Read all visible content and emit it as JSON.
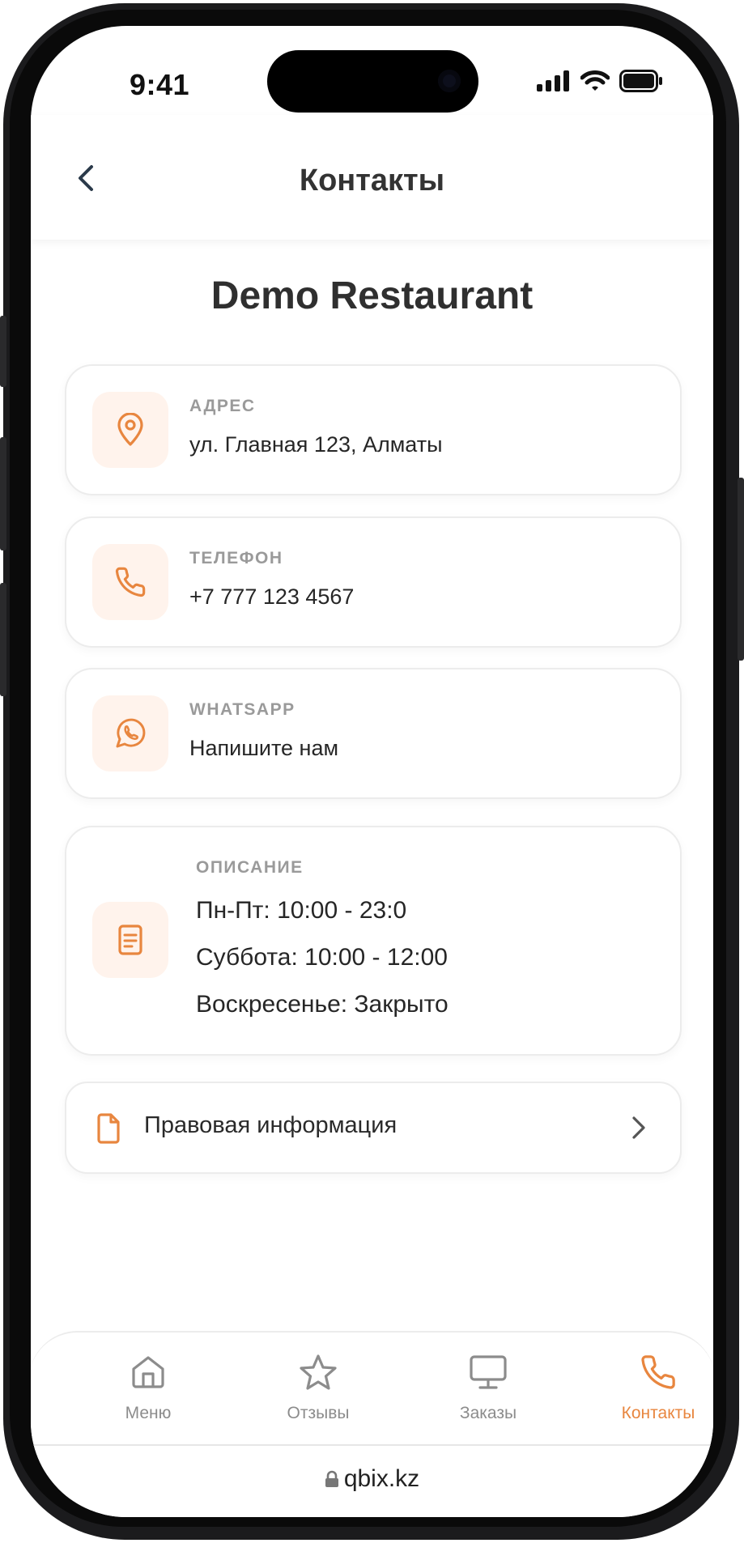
{
  "status": {
    "time": "9:41"
  },
  "header": {
    "title": "Контакты"
  },
  "restaurant": {
    "name": "Demo Restaurant"
  },
  "cards": {
    "address": {
      "label": "АДРЕС",
      "value": "ул. Главная 123, Алматы"
    },
    "phone": {
      "label": "ТЕЛЕФОН",
      "value": "+7 777 123 4567"
    },
    "whatsapp": {
      "label": "WHATSAPP",
      "value": "Напишите нам"
    },
    "description": {
      "label": "ОПИСАНИЕ",
      "lines": [
        "Пн-Пт: 10:00 - 23:0",
        "Суббота: 10:00 - 12:00",
        "Воскресенье: Закрыто"
      ]
    }
  },
  "legal": {
    "label": "Правовая информация"
  },
  "tabs": [
    {
      "label": "Меню",
      "icon": "home-icon"
    },
    {
      "label": "Отзывы",
      "icon": "star-icon"
    },
    {
      "label": "Заказы",
      "icon": "monitor-icon"
    },
    {
      "label": "Контакты",
      "icon": "phone-icon",
      "active": true
    }
  ],
  "browser": {
    "url": "qbix.kz"
  },
  "colors": {
    "accent": "#e8863f",
    "accent_bg": "#fff3ec",
    "text": "#262626",
    "muted": "#9a9a9a"
  }
}
